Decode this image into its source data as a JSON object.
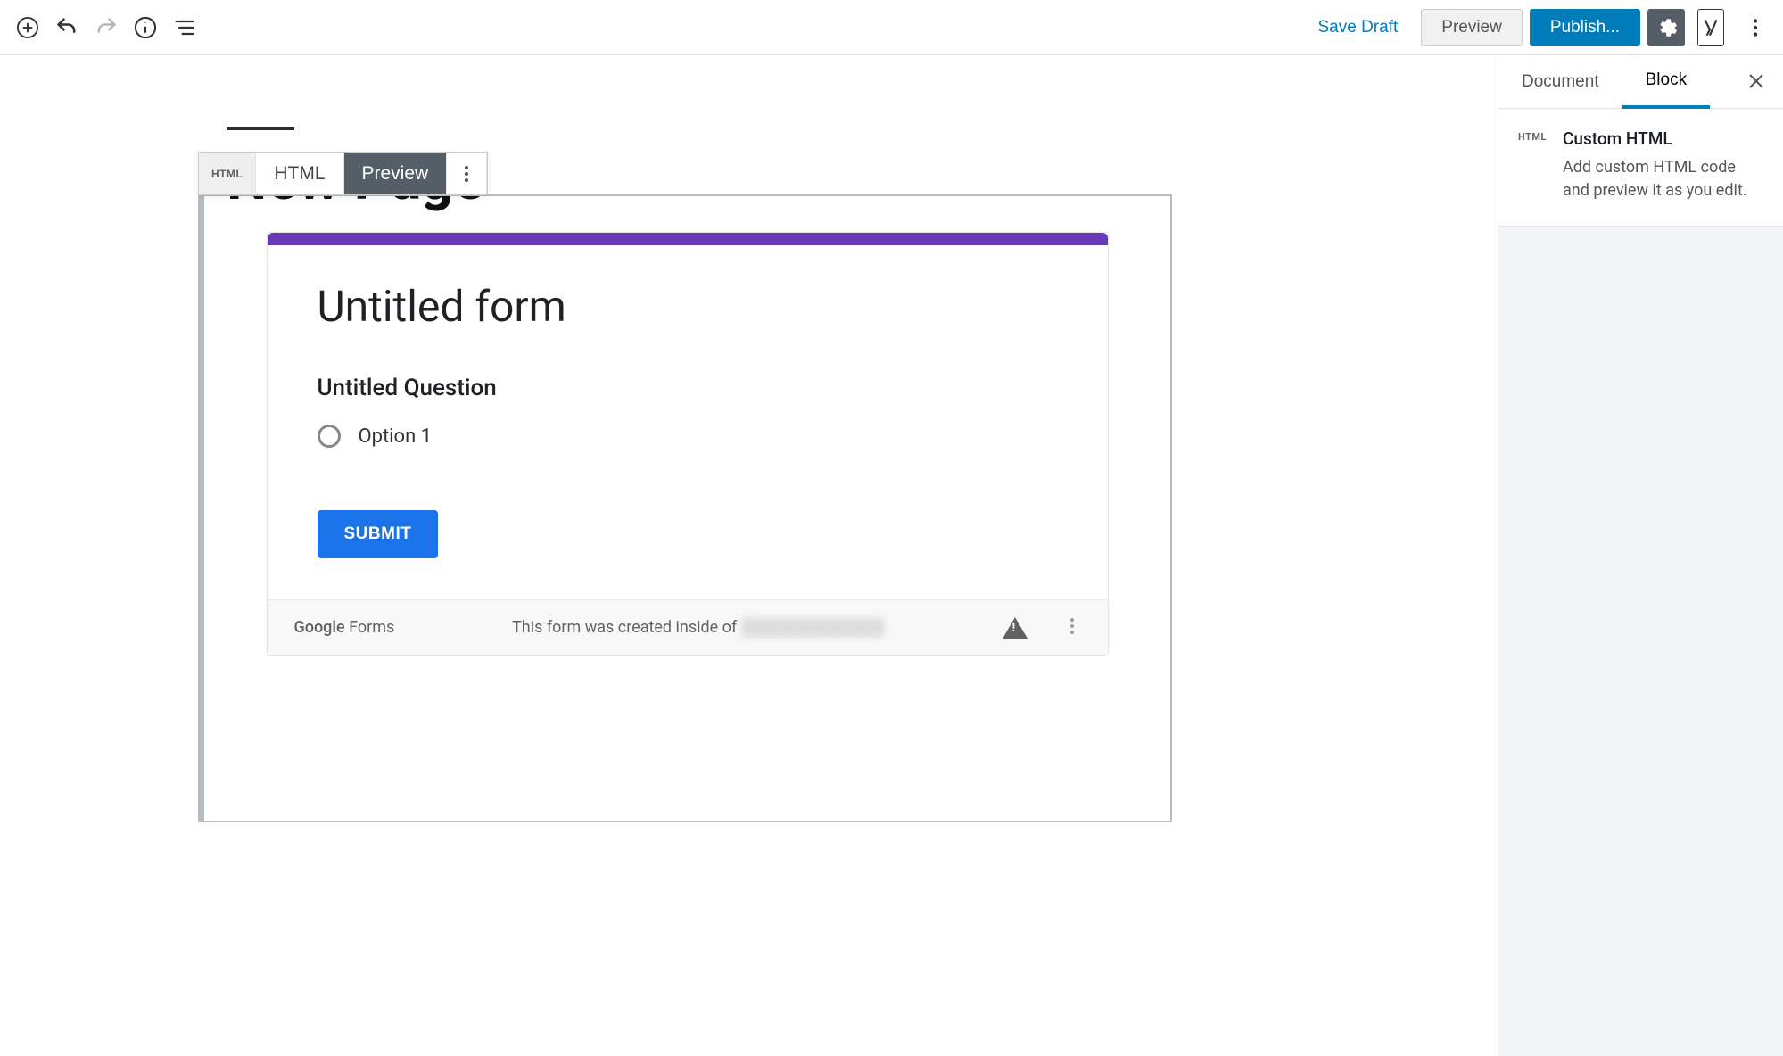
{
  "topbar": {
    "save_draft": "Save Draft",
    "preview": "Preview",
    "publish": "Publish..."
  },
  "editor": {
    "page_title": "New Page"
  },
  "block_tabs": {
    "icon_label": "HTML",
    "html": "HTML",
    "preview": "Preview"
  },
  "gform": {
    "title": "Untitled form",
    "question": "Untitled Question",
    "option1": "Option 1",
    "submit": "SUBMIT",
    "brand_google": "Google",
    "brand_forms": " Forms",
    "created_prefix": "This form was created inside of ",
    "created_blur": "████████████"
  },
  "sidebar": {
    "tabs": {
      "document": "Document",
      "block": "Block"
    },
    "block": {
      "icon": "HTML",
      "title": "Custom HTML",
      "desc": "Add custom HTML code and preview it as you edit."
    }
  }
}
